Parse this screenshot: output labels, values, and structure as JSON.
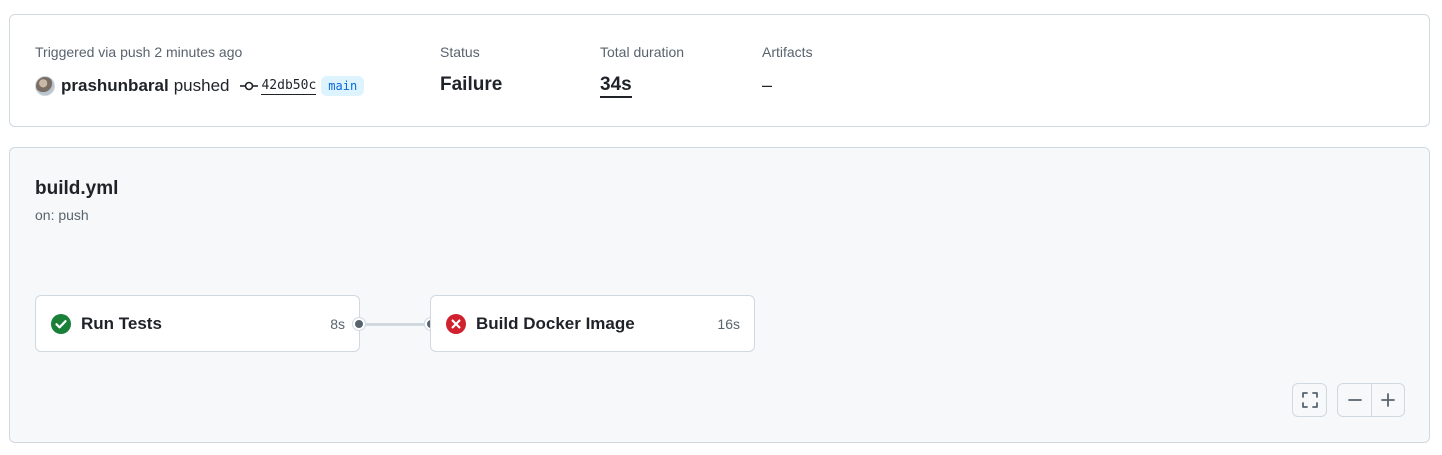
{
  "summary": {
    "trigger_text": "Triggered via push 2 minutes ago",
    "actor": "prashunbaral",
    "action": "pushed",
    "commit_sha": "42db50c",
    "branch": "main",
    "status_label": "Status",
    "status_value": "Failure",
    "duration_label": "Total duration",
    "duration_value": "34s",
    "artifacts_label": "Artifacts",
    "artifacts_value": "–"
  },
  "workflow": {
    "name": "build.yml",
    "event": "on: push",
    "jobs": [
      {
        "name": "Run Tests",
        "duration": "8s",
        "status": "success",
        "icon": "check-circle-fill-icon",
        "color": "#1a7f37"
      },
      {
        "name": "Build Docker Image",
        "duration": "16s",
        "status": "failure",
        "icon": "x-circle-fill-icon",
        "color": "#cf222e"
      }
    ],
    "controls": [
      "fullscreen-icon",
      "zoom-out-icon",
      "zoom-in-icon"
    ]
  },
  "colors": {
    "success": "#1a7f37",
    "failure": "#cf222e",
    "branch_bg": "#ddf4ff",
    "branch_text": "#0969da",
    "muted_text": "#59636e",
    "border": "#d1d9e0"
  }
}
